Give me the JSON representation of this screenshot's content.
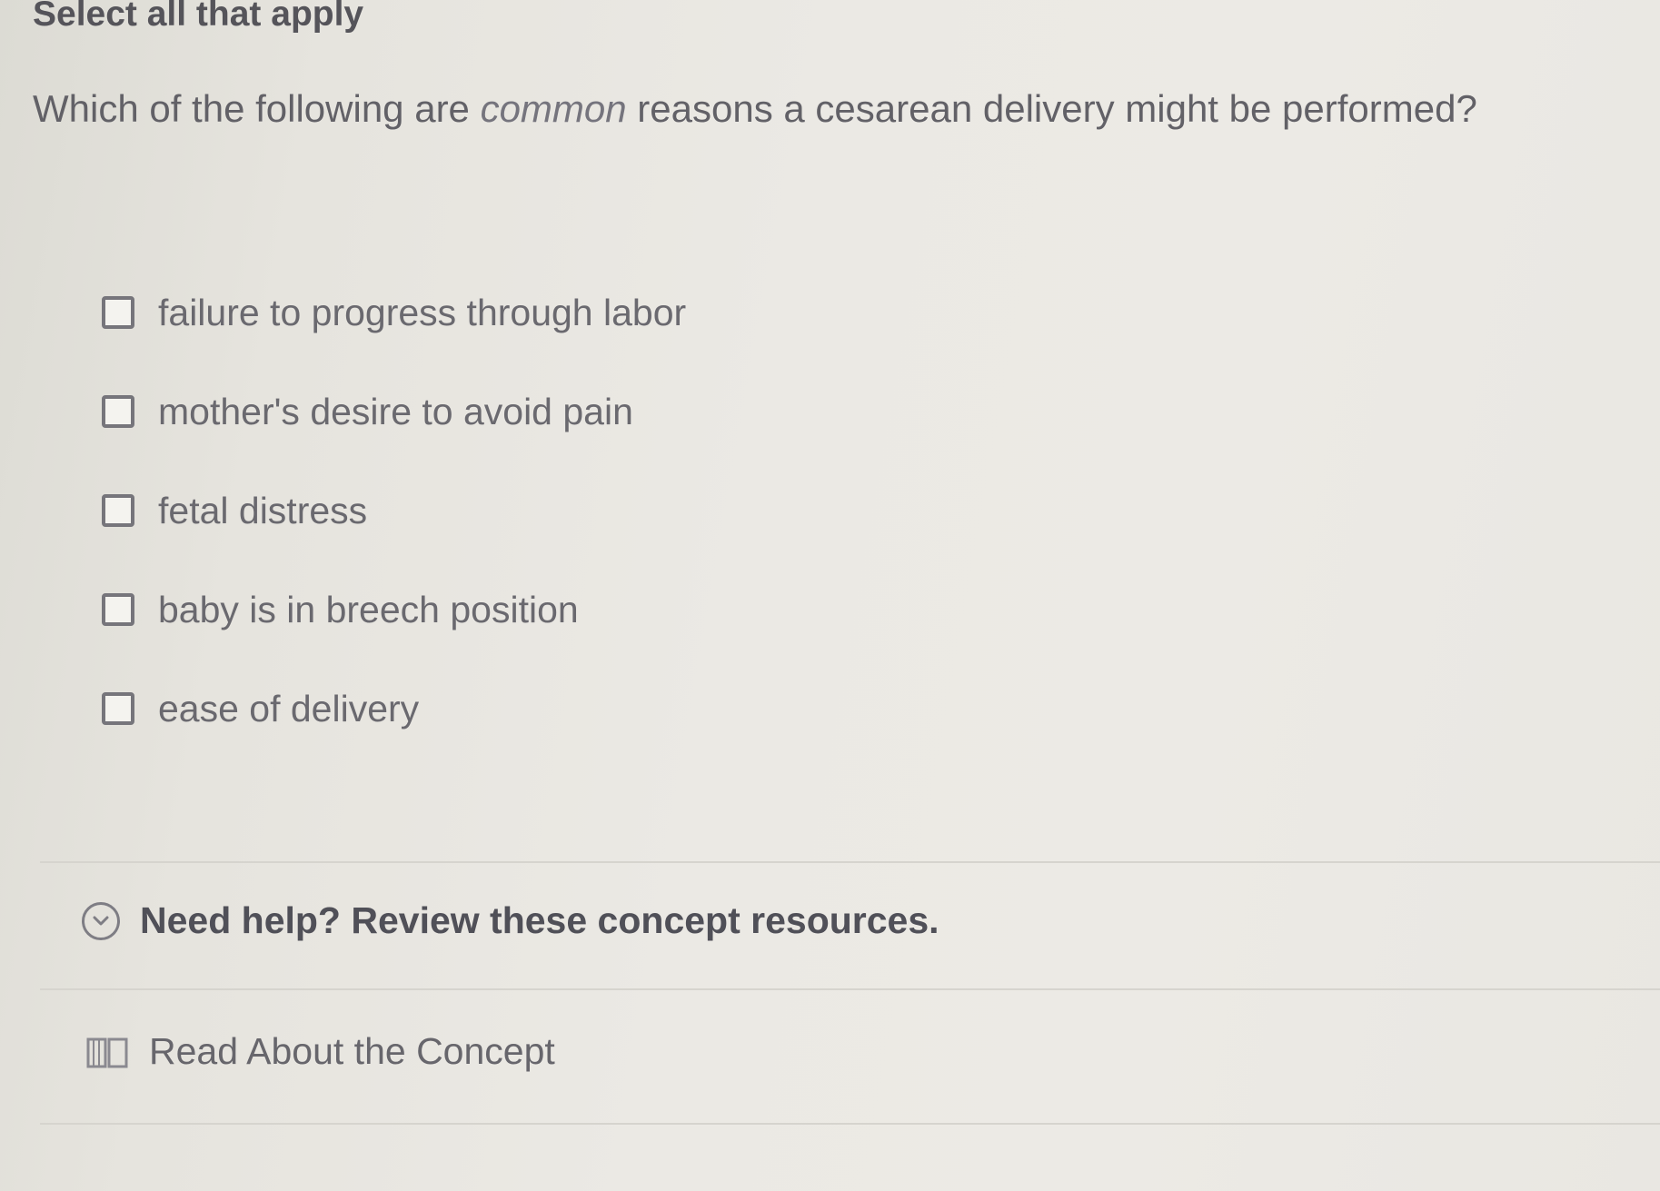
{
  "header": {
    "instructions": "Select all that apply"
  },
  "question": {
    "prefix": "Which of the following are ",
    "emphasis": "common",
    "suffix": " reasons a cesarean delivery might be performed?"
  },
  "options": [
    {
      "label": "failure to progress through labor",
      "checked": false
    },
    {
      "label": "mother's desire to avoid pain",
      "checked": false
    },
    {
      "label": "fetal distress",
      "checked": false
    },
    {
      "label": "baby is in breech position",
      "checked": false
    },
    {
      "label": "ease of delivery",
      "checked": false
    }
  ],
  "help": {
    "label": "Need help? Review these concept resources.",
    "icon": "chevron-circle-icon"
  },
  "resources": {
    "read_label": "Read About the Concept",
    "icon": "book-icon"
  }
}
